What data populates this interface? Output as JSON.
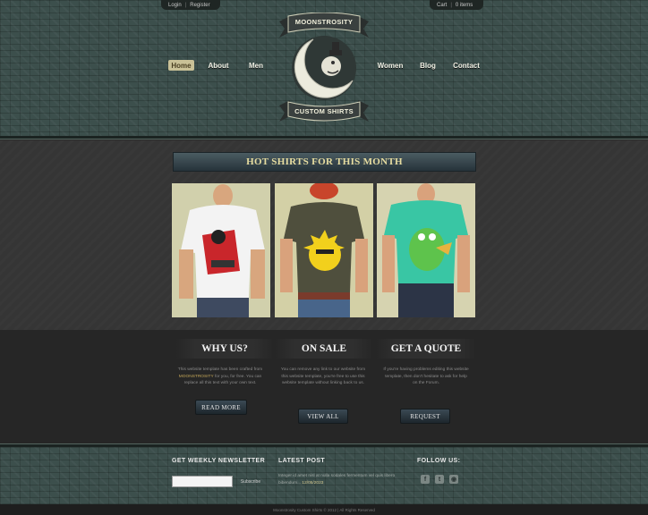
{
  "topbar": {
    "login": "Login",
    "register": "Register",
    "cart": "Cart",
    "items": "0 items"
  },
  "nav": {
    "home": "Home",
    "about": "About",
    "men": "Men",
    "women": "Women",
    "blog": "Blog",
    "contact": "Contact"
  },
  "logo": {
    "top_text": "MOONSTROSITY",
    "bottom_text": "CUSTOM SHIRTS"
  },
  "featured": {
    "title": "HOT SHIRTS FOR THIS MONTH",
    "shirts": [
      {
        "shirt_color": "#f3f3f3",
        "art": "devil-robot-graphic"
      },
      {
        "shirt_color": "#4f4f3d",
        "art": "sun-face-graphic"
      },
      {
        "shirt_color": "#39c6a4",
        "art": "green-dinosaur-graphic"
      }
    ]
  },
  "info": {
    "why_us": {
      "title": "WHY US?",
      "text_before": "This website template has been crafted from ",
      "link": "MOONSTROSITY",
      "text_after": " for you, for free. You can replace all this text with your own text.",
      "button": "READ MORE"
    },
    "on_sale": {
      "title": "ON SALE",
      "text": "You can remove any link to our website from this website template, you're free to use this website template without linking back to us.",
      "button": "VIEW ALL"
    },
    "quote": {
      "title": "GET A QUOTE",
      "text": "If you're having problems editing this website template, then don't hesitate to ask for help on the Forum.",
      "button": "REQUEST"
    }
  },
  "footer": {
    "newsletter_title": "GET WEEKLY NEWSLETTER",
    "newsletter_placeholder": "",
    "subscribe": "Subscribe",
    "latest_post_title": "LATEST POST",
    "latest_post_text": "Integer id amet nisl at nulla sodales fermentum vel quis libero bibendum...",
    "latest_post_date": "12/05/2023",
    "follow_title": "FOLLOW US:",
    "copyright": "Moonstrosity Custom Shirts © 2012 | All Rights Reserved"
  },
  "colors": {
    "header_texture": "#3c4f4c",
    "accent_gold": "#e6dca0",
    "active_nav": "#c9c197",
    "dark_band": "#262626"
  }
}
